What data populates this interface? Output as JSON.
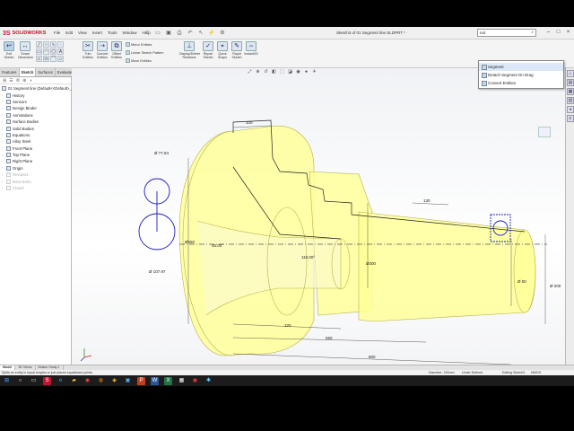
{
  "app": {
    "logo_ds": "3S",
    "logo_name": "SOLIDWORKS",
    "menu": [
      "File",
      "Edit",
      "View",
      "Insert",
      "Tools",
      "Window",
      "Help"
    ],
    "doc_title": "Sketch3 of 01 Segment line.SLDPRT *",
    "search_value": "not"
  },
  "ribbon": {
    "exit_sketch": "Exit Sketch",
    "smart_dimension": "Smart Dimension",
    "trim_entities": "Trim Entities",
    "convert_entities": "Convert Entities",
    "offset_entities": "Offset Entities",
    "mirror_entities": "Mirror Entities",
    "linear_pattern": "Linear Sketch Pattern",
    "move_entities": "Move Entities",
    "display_delete": "Display/Delete Relations",
    "repair_sketch": "Repair Sketch",
    "quick_snaps": "Quick Snaps",
    "rapid_sketch": "Rapid Sketch",
    "instant2d": "Instant2D"
  },
  "command_tabs": [
    "Features",
    "Sketch",
    "Surfaces",
    "Evaluate"
  ],
  "tree": {
    "root": "01 Segment line (Default<<Default>_Dis",
    "items": [
      {
        "label": "History",
        "dim": false
      },
      {
        "label": "Sensors",
        "dim": false
      },
      {
        "label": "Design Binder",
        "dim": false
      },
      {
        "label": "Annotations",
        "dim": false
      },
      {
        "label": "Surface Bodies",
        "dim": false
      },
      {
        "label": "Solid Bodies",
        "dim": false
      },
      {
        "label": "Equations",
        "dim": false
      },
      {
        "label": "Alloy Steel",
        "dim": false
      },
      {
        "label": "Front Plane",
        "dim": false
      },
      {
        "label": "Top Plane",
        "dim": false
      },
      {
        "label": "Right Plane",
        "dim": false
      },
      {
        "label": "Origin",
        "dim": false
      },
      {
        "label": "Revolve1",
        "dim": true
      },
      {
        "label": "Boss-Extr1",
        "dim": true
      },
      {
        "label": "Chamf",
        "dim": true
      }
    ]
  },
  "dropdown": {
    "items": [
      "Segment",
      "Detach Segment On Drag",
      "Convert Entities"
    ]
  },
  "dimensions": {
    "d100": "100",
    "d7784": "Ø 77.84",
    "d10797": "Ø 107.97",
    "d550": "Ø550",
    "d4500": "45.00°",
    "d11000": "110.00°",
    "d300": "Ø300",
    "d130": "130",
    "d50": "Ø 50",
    "d200": "Ø 200",
    "d320": "320",
    "d550b": "550",
    "d800": "800"
  },
  "bottom_tabs": [
    "Model",
    "3D Views",
    "Motion Study 1"
  ],
  "status": {
    "message": "Splits an entity in equal lengths or just places equidistant points.",
    "diameter": "Diameter: 200mm",
    "defined": "Under Defined",
    "editing": "Editing Sketch3",
    "units": "MMGS"
  },
  "colors": {
    "part_fill": "#ffff9a",
    "sketch_blue": "#1d1dbf",
    "brand": "#c8102e"
  }
}
